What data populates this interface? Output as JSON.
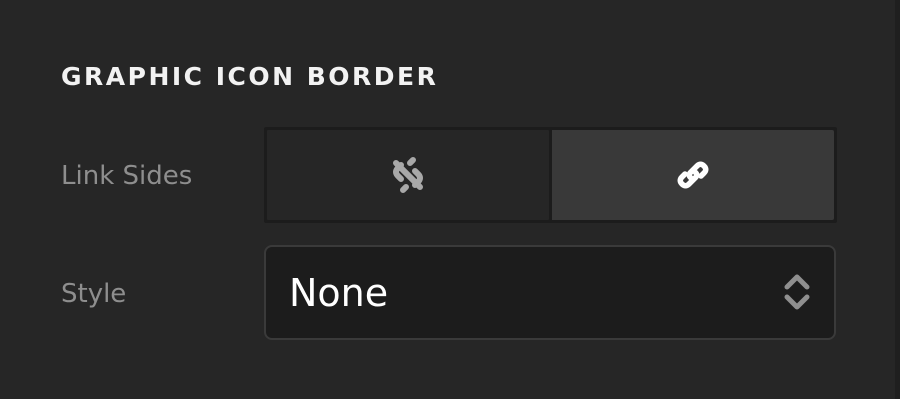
{
  "section": {
    "title": "GRAPHIC ICON BORDER"
  },
  "link_sides": {
    "label": "Link Sides",
    "options": [
      {
        "icon": "unlink-icon",
        "selected": false
      },
      {
        "icon": "link-icon",
        "selected": true
      }
    ]
  },
  "style": {
    "label": "Style",
    "value": "None",
    "arrows_icon": "up-down-arrows-icon"
  },
  "colors": {
    "background": "#262626",
    "control_background": "#1c1c1c",
    "selected_toggle": "#393939",
    "label_text": "#8e8e8e",
    "title_text": "#f2f2f2"
  }
}
